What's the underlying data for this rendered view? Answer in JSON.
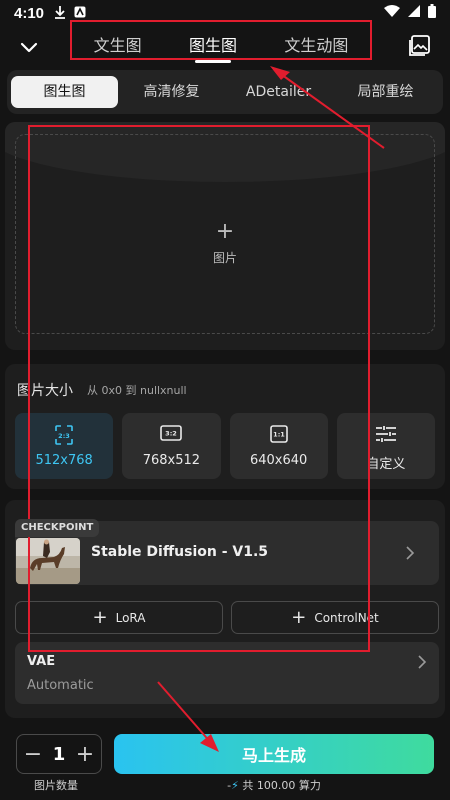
{
  "status_bar": {
    "time": "4:10"
  },
  "header": {
    "tabs": [
      {
        "label": "文生图"
      },
      {
        "label": "图生图"
      },
      {
        "label": "文生动图"
      }
    ]
  },
  "sub_tabs": [
    {
      "label": "图生图"
    },
    {
      "label": "高清修复"
    },
    {
      "label": "ADetailer"
    },
    {
      "label": "局部重绘"
    }
  ],
  "upload": {
    "plus": "+",
    "label": "图片"
  },
  "size": {
    "title": "图片大小",
    "subtitle": "从 0x0 到 nullxnull",
    "options": [
      {
        "ratio": "2:3",
        "value": "512x768"
      },
      {
        "ratio": "3:2",
        "value": "768x512"
      },
      {
        "ratio": "1:1",
        "value": "640x640"
      },
      {
        "value": "自定义"
      }
    ]
  },
  "model": {
    "badge": "CHECKPOINT",
    "name": "Stable Diffusion - V1.5",
    "lora": "LoRA",
    "controlnet": "ControlNet",
    "vae_label": "VAE",
    "vae_value": "Automatic"
  },
  "bottom": {
    "minus": "−",
    "count": "1",
    "plus": "+",
    "count_label": "图片数量",
    "generate": "马上生成",
    "cost_prefix": "-",
    "cost_text": "共 100.00 算力"
  },
  "colors": {
    "accent": "#3ec6f3",
    "gradient_start": "#2ac3f0",
    "gradient_end": "#3fdb9e",
    "annotation": "#e11d2e"
  }
}
